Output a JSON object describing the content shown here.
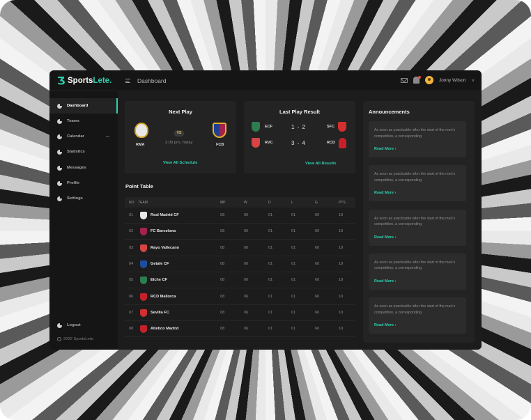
{
  "brand": {
    "name_main": "Sports",
    "name_accent": "Lete.",
    "accent_color": "#2fcfae"
  },
  "header": {
    "page_title": "Dashboard",
    "user_name": "Jonny Wilson",
    "icons": [
      "mail-icon",
      "bell-icon",
      "avatar",
      "chevron-down-icon"
    ]
  },
  "sidebar": {
    "items": [
      {
        "label": "Dashboard",
        "active": true
      },
      {
        "label": "Teams"
      },
      {
        "label": "Calendar"
      },
      {
        "label": "Statistics"
      },
      {
        "label": "Messages"
      },
      {
        "label": "Profile"
      },
      {
        "label": "Settings"
      }
    ],
    "logout": "Logout",
    "copyright": "2022 SportsLete."
  },
  "next_play": {
    "title": "Next Play",
    "home": "RMA",
    "away": "FCB",
    "vs": "VS",
    "time": "2:00 pm, Today",
    "link": "View All Schedule"
  },
  "last_result": {
    "title": "Last Play Result",
    "matches": [
      {
        "home": "ECF",
        "score": "1 - 2",
        "away": "SFC"
      },
      {
        "home": "RVC",
        "score": "3 - 4",
        "away": "RCD"
      }
    ],
    "link": "View All Results"
  },
  "point_table": {
    "title": "Point Table",
    "columns": [
      "NO",
      "TEAM",
      "MP",
      "W",
      "D",
      "L",
      "G",
      "PTS"
    ],
    "rows": [
      {
        "no": "01",
        "team": "Real Madrid CF",
        "mp": "08",
        "w": "06",
        "d": "01",
        "l": "01",
        "g": "60",
        "pts": "19"
      },
      {
        "no": "02",
        "team": "FC Barcelona",
        "mp": "08",
        "w": "06",
        "d": "01",
        "l": "01",
        "g": "60",
        "pts": "19"
      },
      {
        "no": "03",
        "team": "Rayo Vallecano",
        "mp": "08",
        "w": "06",
        "d": "01",
        "l": "01",
        "g": "60",
        "pts": "19"
      },
      {
        "no": "04",
        "team": "Getafe CF",
        "mp": "08",
        "w": "06",
        "d": "01",
        "l": "01",
        "g": "60",
        "pts": "19"
      },
      {
        "no": "05",
        "team": "Elche CF",
        "mp": "08",
        "w": "06",
        "d": "01",
        "l": "01",
        "g": "60",
        "pts": "19"
      },
      {
        "no": "06",
        "team": "RCD Mallorca",
        "mp": "08",
        "w": "06",
        "d": "01",
        "l": "01",
        "g": "60",
        "pts": "19"
      },
      {
        "no": "07",
        "team": "Sevilla FC",
        "mp": "08",
        "w": "06",
        "d": "01",
        "l": "01",
        "g": "60",
        "pts": "19"
      },
      {
        "no": "08",
        "team": "Atletico Madrid",
        "mp": "08",
        "w": "06",
        "d": "01",
        "l": "01",
        "g": "60",
        "pts": "19"
      }
    ]
  },
  "announcements": {
    "title": "Announcements",
    "items": [
      {
        "text": "As soon as practicable after the start of the men's competition, a corresponding",
        "link": "Read More"
      },
      {
        "text": "As soon as practicable after the start of the men's competition, a corresponding",
        "link": "Read More"
      },
      {
        "text": "As soon as practicable after the start of the men's competition, a corresponding",
        "link": "Read More"
      },
      {
        "text": "As soon as practicable after the start of the men's competition, a corresponding",
        "link": "Read More"
      },
      {
        "text": "As soon as practicable after the start of the men's competition, a corresponding",
        "link": "Read More"
      }
    ]
  },
  "crest_colors": {
    "RMA": "#e8e8e8",
    "FCB": "#a7224a",
    "ECF": "#2e7d4f",
    "SFC": "#d32f2f",
    "RVC": "#d84343",
    "RCD": "#c8202b",
    "rows": [
      "#e8e8e8",
      "#a7224a",
      "#d84343",
      "#1d4fa0",
      "#2e7d4f",
      "#c8202b",
      "#d32f2f",
      "#c8202b"
    ]
  }
}
